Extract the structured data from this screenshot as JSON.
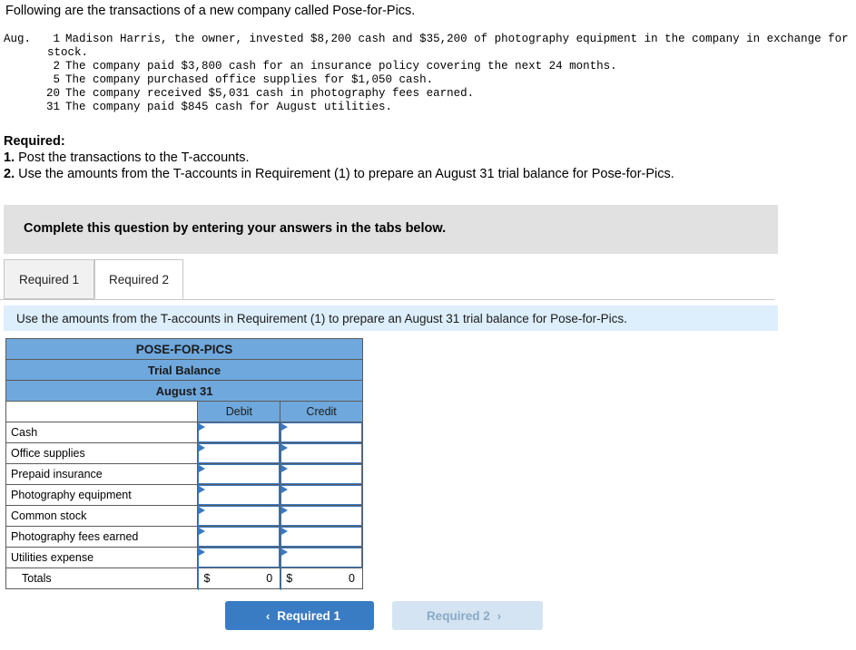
{
  "intro": "Following are the transactions of a new company called Pose-for-Pics.",
  "transactions": [
    {
      "month": "Aug.",
      "day": "1",
      "text": "Madison Harris, the owner, invested $8,200 cash and $35,200 of photography equipment in the company in exchange for common",
      "cont": "stock."
    },
    {
      "month": "",
      "day": "2",
      "text": "The company paid $3,800 cash for an insurance policy covering the next 24 months.",
      "cont": ""
    },
    {
      "month": "",
      "day": "5",
      "text": "The company purchased office supplies for $1,050 cash.",
      "cont": ""
    },
    {
      "month": "",
      "day": "20",
      "text": "The company received $5,031 cash in photography fees earned.",
      "cont": ""
    },
    {
      "month": "",
      "day": "31",
      "text": "The company paid $845 cash for August utilities.",
      "cont": ""
    }
  ],
  "required": {
    "heading": "Required:",
    "item1_num": "1.",
    "item1_text": " Post the transactions to the T-accounts.",
    "item2_num": "2.",
    "item2_text": " Use the amounts from the T-accounts in Requirement (1) to prepare an August 31 trial balance for Pose-for-Pics."
  },
  "grey_bar": {
    "text": "Complete this question by entering your answers in the tabs below."
  },
  "tabs": [
    {
      "label": "Required 1",
      "active": false
    },
    {
      "label": "Required 2",
      "active": true
    }
  ],
  "blue_strip": {
    "text": "Use the amounts from the T-accounts in Requirement (1) to prepare an August 31 trial balance for Pose-for-Pics."
  },
  "table": {
    "title": "POSE-FOR-PICS",
    "subtitle": "Trial Balance",
    "date": "August 31",
    "columns": [
      "",
      "Debit",
      "Credit"
    ],
    "rows": [
      {
        "account": "Cash",
        "debit": "",
        "credit": ""
      },
      {
        "account": "Office supplies",
        "debit": "",
        "credit": ""
      },
      {
        "account": "Prepaid insurance",
        "debit": "",
        "credit": ""
      },
      {
        "account": "Photography equipment",
        "debit": "",
        "credit": ""
      },
      {
        "account": "Common stock",
        "debit": "",
        "credit": ""
      },
      {
        "account": "Photography fees earned",
        "debit": "",
        "credit": ""
      },
      {
        "account": "Utilities expense",
        "debit": "",
        "credit": ""
      }
    ],
    "totals": {
      "label": "Totals",
      "debit_symbol": "$",
      "debit_value": "0",
      "credit_symbol": "$",
      "credit_value": "0"
    }
  },
  "nav": {
    "prev_label": "Required 1",
    "prev_chevron": "‹",
    "next_label": "Required 2",
    "next_chevron": "›"
  }
}
